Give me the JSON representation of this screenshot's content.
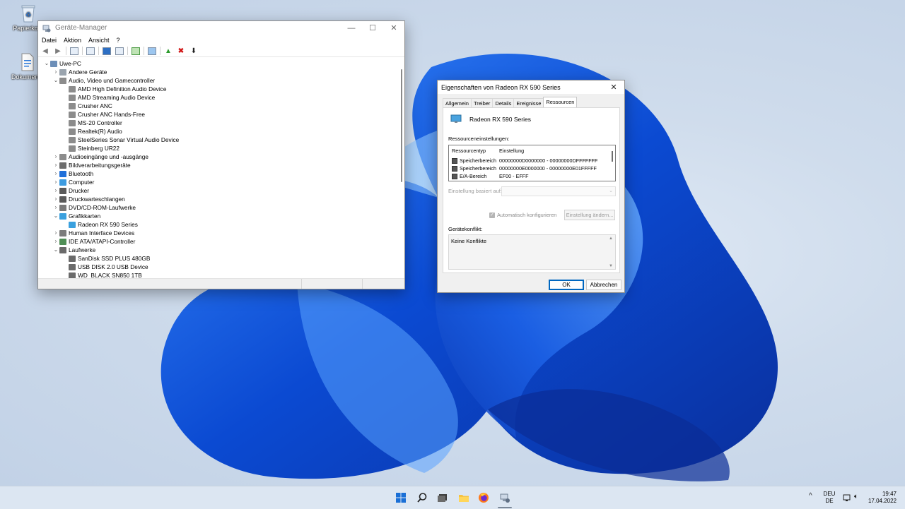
{
  "desktop": {
    "icons": [
      {
        "label": "Papierkorb"
      },
      {
        "label": "Dokumente"
      }
    ]
  },
  "devmgr": {
    "title": "Geräte-Manager",
    "menu": [
      "Datei",
      "Aktion",
      "Ansicht",
      "?"
    ],
    "tree": [
      {
        "label": "Uwe-PC",
        "level": 0,
        "state": "expanded",
        "icon": "computer-icon"
      },
      {
        "label": "Andere Geräte",
        "level": 1,
        "state": "collapsed",
        "icon": "unknown-device-icon"
      },
      {
        "label": "Audio, Video und Gamecontroller",
        "level": 1,
        "state": "expanded",
        "icon": "speaker-icon"
      },
      {
        "label": "AMD High Definition Audio Device",
        "level": 2,
        "state": "leaf",
        "icon": "speaker-icon"
      },
      {
        "label": "AMD Streaming Audio Device",
        "level": 2,
        "state": "leaf",
        "icon": "speaker-icon"
      },
      {
        "label": "Crusher ANC",
        "level": 2,
        "state": "leaf",
        "icon": "speaker-icon"
      },
      {
        "label": "Crusher ANC Hands-Free",
        "level": 2,
        "state": "leaf",
        "icon": "speaker-icon"
      },
      {
        "label": "MS-20 Controller",
        "level": 2,
        "state": "leaf",
        "icon": "speaker-icon"
      },
      {
        "label": "Realtek(R) Audio",
        "level": 2,
        "state": "leaf",
        "icon": "speaker-icon"
      },
      {
        "label": "SteelSeries Sonar Virtual Audio Device",
        "level": 2,
        "state": "leaf",
        "icon": "speaker-icon"
      },
      {
        "label": "Steinberg UR22",
        "level": 2,
        "state": "leaf",
        "icon": "speaker-icon"
      },
      {
        "label": "Audioeingänge und -ausgänge",
        "level": 1,
        "state": "collapsed",
        "icon": "speaker-icon"
      },
      {
        "label": "Bildverarbeitungsgeräte",
        "level": 1,
        "state": "collapsed",
        "icon": "camera-icon"
      },
      {
        "label": "Bluetooth",
        "level": 1,
        "state": "collapsed",
        "icon": "bluetooth-icon"
      },
      {
        "label": "Computer",
        "level": 1,
        "state": "collapsed",
        "icon": "monitor-icon"
      },
      {
        "label": "Drucker",
        "level": 1,
        "state": "collapsed",
        "icon": "printer-icon"
      },
      {
        "label": "Druckwarteschlangen",
        "level": 1,
        "state": "collapsed",
        "icon": "printer-icon"
      },
      {
        "label": "DVD/CD-ROM-Laufwerke",
        "level": 1,
        "state": "collapsed",
        "icon": "disc-drive-icon"
      },
      {
        "label": "Grafikkarten",
        "level": 1,
        "state": "expanded",
        "icon": "display-adapter-icon"
      },
      {
        "label": "Radeon RX 590 Series",
        "level": 2,
        "state": "leaf",
        "icon": "display-adapter-icon"
      },
      {
        "label": "Human Interface Devices",
        "level": 1,
        "state": "collapsed",
        "icon": "hid-icon"
      },
      {
        "label": "IDE ATA/ATAPI-Controller",
        "level": 1,
        "state": "collapsed",
        "icon": "controller-icon"
      },
      {
        "label": "Laufwerke",
        "level": 1,
        "state": "expanded",
        "icon": "drive-icon"
      },
      {
        "label": "SanDisk SSD PLUS 480GB",
        "level": 2,
        "state": "leaf",
        "icon": "drive-icon"
      },
      {
        "label": "USB DISK 2.0 USB Device",
        "level": 2,
        "state": "leaf",
        "icon": "drive-icon"
      },
      {
        "label": "WD_BLACK SN850 1TB",
        "level": 2,
        "state": "leaf",
        "icon": "drive-icon"
      }
    ]
  },
  "props": {
    "title": "Eigenschaften von Radeon RX 590 Series",
    "tabs": [
      "Allgemein",
      "Treiber",
      "Details",
      "Ereignisse",
      "Ressourcen"
    ],
    "active_tab": "Ressourcen",
    "device_name": "Radeon RX 590 Series",
    "resource_settings_label": "Ressourceneinstellungen:",
    "columns": [
      "Ressourcentyp",
      "Einstellung"
    ],
    "rows": [
      {
        "type": "Speicherbereich",
        "value": "00000000D0000000 - 00000000DFFFFFFF"
      },
      {
        "type": "Speicherbereich",
        "value": "00000000E0000000 - 00000000E01FFFFF"
      },
      {
        "type": "E/A-Bereich",
        "value": "EF00 - EFFF"
      }
    ],
    "based_on_label": "Einstellung basiert auf:",
    "auto_configure_label": "Automatisch konfigurieren",
    "change_setting_label": "Einstellung ändern...",
    "conflict_label": "Gerätekonflikt:",
    "conflict_text": "Keine Konflikte",
    "ok_label": "OK",
    "cancel_label": "Abbrechen"
  },
  "taskbar": {
    "lang_top": "DEU",
    "lang_bottom": "DE",
    "time": "19:47",
    "date": "17.04.2022"
  },
  "colors": {
    "accent": "#0067c0",
    "wallpaper_blue": "#1a5fd9",
    "taskbar": "#dce6f2"
  }
}
